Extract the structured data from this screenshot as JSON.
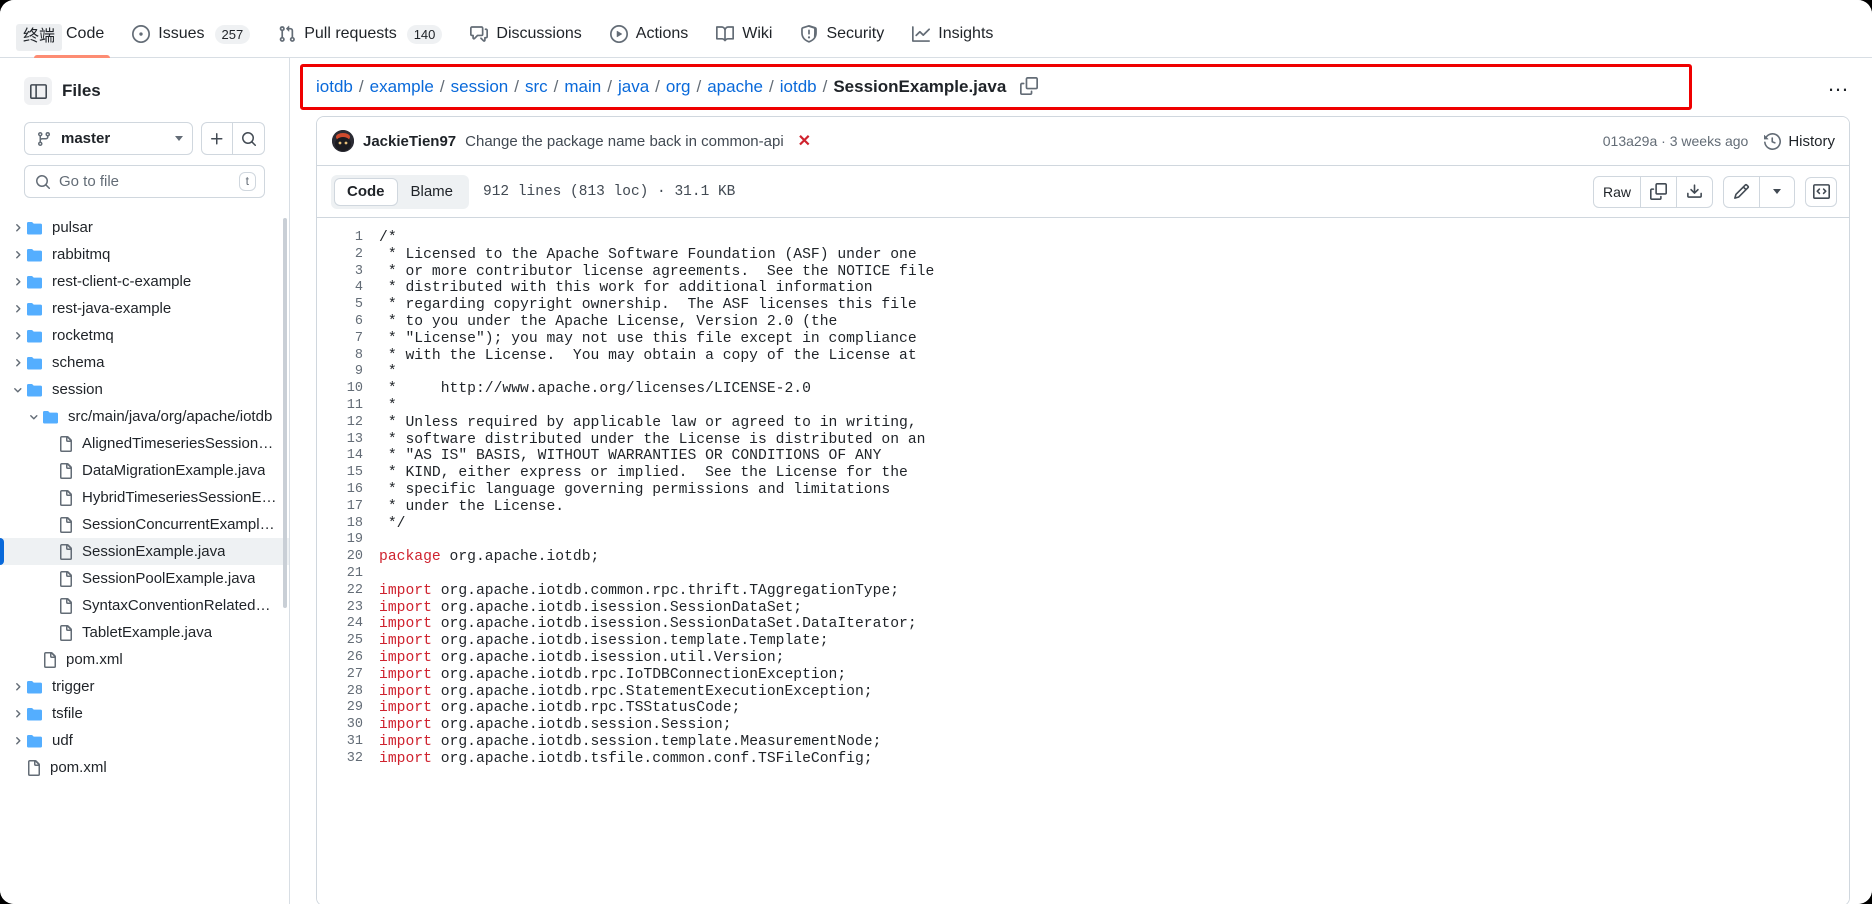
{
  "tooltip": {
    "text": "终端"
  },
  "nav": {
    "items": [
      {
        "label": "Code",
        "icon": "code-icon",
        "count": null,
        "active": true
      },
      {
        "label": "Issues",
        "icon": "issue-opened-icon",
        "count": "257",
        "active": false
      },
      {
        "label": "Pull requests",
        "icon": "git-pull-request-icon",
        "count": "140",
        "active": false
      },
      {
        "label": "Discussions",
        "icon": "comment-discussion-icon",
        "count": null,
        "active": false
      },
      {
        "label": "Actions",
        "icon": "play-icon",
        "count": null,
        "active": false
      },
      {
        "label": "Wiki",
        "icon": "book-icon",
        "count": null,
        "active": false
      },
      {
        "label": "Security",
        "icon": "shield-icon",
        "count": null,
        "active": false
      },
      {
        "label": "Insights",
        "icon": "graph-icon",
        "count": null,
        "active": false
      }
    ]
  },
  "sidebar": {
    "title": "Files",
    "toggle_icon": "sidebar-collapse-icon",
    "branch": {
      "name": "master",
      "icon": "git-branch-icon"
    },
    "add_button_icon": "plus-icon",
    "search_button_icon": "search-icon",
    "go_to_file": {
      "placeholder": "Go to file",
      "shortcut": "t",
      "icon": "search-icon"
    },
    "tree": [
      {
        "label": "pulsar",
        "type": "folder",
        "depth": 1,
        "expanded": false,
        "selected": false
      },
      {
        "label": "rabbitmq",
        "type": "folder",
        "depth": 1,
        "expanded": false,
        "selected": false
      },
      {
        "label": "rest-client-c-example",
        "type": "folder",
        "depth": 1,
        "expanded": false,
        "selected": false
      },
      {
        "label": "rest-java-example",
        "type": "folder",
        "depth": 1,
        "expanded": false,
        "selected": false
      },
      {
        "label": "rocketmq",
        "type": "folder",
        "depth": 1,
        "expanded": false,
        "selected": false
      },
      {
        "label": "schema",
        "type": "folder",
        "depth": 1,
        "expanded": false,
        "selected": false
      },
      {
        "label": "session",
        "type": "folder",
        "depth": 1,
        "expanded": true,
        "selected": false
      },
      {
        "label": "src/main/java/org/apache/iotdb",
        "type": "folder",
        "depth": 2,
        "expanded": true,
        "selected": false
      },
      {
        "label": "AlignedTimeseriesSessionE…",
        "type": "file",
        "depth": 3,
        "expanded": false,
        "selected": false
      },
      {
        "label": "DataMigrationExample.java",
        "type": "file",
        "depth": 3,
        "expanded": false,
        "selected": false
      },
      {
        "label": "HybridTimeseriesSessionEx…",
        "type": "file",
        "depth": 3,
        "expanded": false,
        "selected": false
      },
      {
        "label": "SessionConcurrentExample.…",
        "type": "file",
        "depth": 3,
        "expanded": false,
        "selected": false
      },
      {
        "label": "SessionExample.java",
        "type": "file",
        "depth": 3,
        "expanded": false,
        "selected": true
      },
      {
        "label": "SessionPoolExample.java",
        "type": "file",
        "depth": 3,
        "expanded": false,
        "selected": false
      },
      {
        "label": "SyntaxConventionRelatedEx…",
        "type": "file",
        "depth": 3,
        "expanded": false,
        "selected": false
      },
      {
        "label": "TabletExample.java",
        "type": "file",
        "depth": 3,
        "expanded": false,
        "selected": false
      },
      {
        "label": "pom.xml",
        "type": "file",
        "depth": 2,
        "expanded": false,
        "selected": false
      },
      {
        "label": "trigger",
        "type": "folder",
        "depth": 1,
        "expanded": false,
        "selected": false
      },
      {
        "label": "tsfile",
        "type": "folder",
        "depth": 1,
        "expanded": false,
        "selected": false
      },
      {
        "label": "udf",
        "type": "folder",
        "depth": 1,
        "expanded": false,
        "selected": false
      },
      {
        "label": "pom.xml",
        "type": "file",
        "depth": 1,
        "expanded": false,
        "selected": false
      }
    ]
  },
  "breadcrumb": {
    "links": [
      "iotdb",
      "example",
      "session",
      "src",
      "main",
      "java",
      "org",
      "apache",
      "iotdb"
    ],
    "current": "SessionExample.java",
    "separator": "/",
    "copy_icon": "copy-path-icon",
    "menu_label": "…",
    "highlight_color": "#ef0000"
  },
  "commit": {
    "author": "JackieTien97",
    "message": "Change the package name back in common-api",
    "status_icon": "x-status-icon",
    "sha": "013a29a",
    "separator": "·",
    "relative_time": "3 weeks ago",
    "history_label": "History",
    "history_icon": "history-icon"
  },
  "file_toolbar": {
    "tabs": [
      {
        "label": "Code",
        "active": true
      },
      {
        "label": "Blame",
        "active": false
      }
    ],
    "meta": "912 lines (813 loc) · 31.1 KB",
    "raw_label": "Raw",
    "copy_icon": "copy-icon",
    "download_icon": "download-icon",
    "edit_icon": "pencil-icon",
    "edit_dropdown_icon": "chevron-down-icon",
    "symbols_icon": "code-brackets-icon"
  },
  "code": {
    "lines": [
      {
        "n": 1,
        "kw": "",
        "text": "/*"
      },
      {
        "n": 2,
        "kw": "",
        "text": " * Licensed to the Apache Software Foundation (ASF) under one"
      },
      {
        "n": 3,
        "kw": "",
        "text": " * or more contributor license agreements.  See the NOTICE file"
      },
      {
        "n": 4,
        "kw": "",
        "text": " * distributed with this work for additional information"
      },
      {
        "n": 5,
        "kw": "",
        "text": " * regarding copyright ownership.  The ASF licenses this file"
      },
      {
        "n": 6,
        "kw": "",
        "text": " * to you under the Apache License, Version 2.0 (the"
      },
      {
        "n": 7,
        "kw": "",
        "text": " * \"License\"); you may not use this file except in compliance"
      },
      {
        "n": 8,
        "kw": "",
        "text": " * with the License.  You may obtain a copy of the License at"
      },
      {
        "n": 9,
        "kw": "",
        "text": " *"
      },
      {
        "n": 10,
        "kw": "",
        "text": " *     http://www.apache.org/licenses/LICENSE-2.0"
      },
      {
        "n": 11,
        "kw": "",
        "text": " *"
      },
      {
        "n": 12,
        "kw": "",
        "text": " * Unless required by applicable law or agreed to in writing,"
      },
      {
        "n": 13,
        "kw": "",
        "text": " * software distributed under the License is distributed on an"
      },
      {
        "n": 14,
        "kw": "",
        "text": " * \"AS IS\" BASIS, WITHOUT WARRANTIES OR CONDITIONS OF ANY"
      },
      {
        "n": 15,
        "kw": "",
        "text": " * KIND, either express or implied.  See the License for the"
      },
      {
        "n": 16,
        "kw": "",
        "text": " * specific language governing permissions and limitations"
      },
      {
        "n": 17,
        "kw": "",
        "text": " * under the License."
      },
      {
        "n": 18,
        "kw": "",
        "text": " */"
      },
      {
        "n": 19,
        "kw": "",
        "text": ""
      },
      {
        "n": 20,
        "kw": "package",
        "text": " org.apache.iotdb;"
      },
      {
        "n": 21,
        "kw": "",
        "text": ""
      },
      {
        "n": 22,
        "kw": "import",
        "text": " org.apache.iotdb.common.rpc.thrift.TAggregationType;"
      },
      {
        "n": 23,
        "kw": "import",
        "text": " org.apache.iotdb.isession.SessionDataSet;"
      },
      {
        "n": 24,
        "kw": "import",
        "text": " org.apache.iotdb.isession.SessionDataSet.DataIterator;"
      },
      {
        "n": 25,
        "kw": "import",
        "text": " org.apache.iotdb.isession.template.Template;"
      },
      {
        "n": 26,
        "kw": "import",
        "text": " org.apache.iotdb.isession.util.Version;"
      },
      {
        "n": 27,
        "kw": "import",
        "text": " org.apache.iotdb.rpc.IoTDBConnectionException;"
      },
      {
        "n": 28,
        "kw": "import",
        "text": " org.apache.iotdb.rpc.StatementExecutionException;"
      },
      {
        "n": 29,
        "kw": "import",
        "text": " org.apache.iotdb.rpc.TSStatusCode;"
      },
      {
        "n": 30,
        "kw": "import",
        "text": " org.apache.iotdb.session.Session;"
      },
      {
        "n": 31,
        "kw": "import",
        "text": " org.apache.iotdb.session.template.MeasurementNode;"
      },
      {
        "n": 32,
        "kw": "import",
        "text": " org.apache.iotdb.tsfile.common.conf.TSFileConfig;"
      }
    ]
  }
}
